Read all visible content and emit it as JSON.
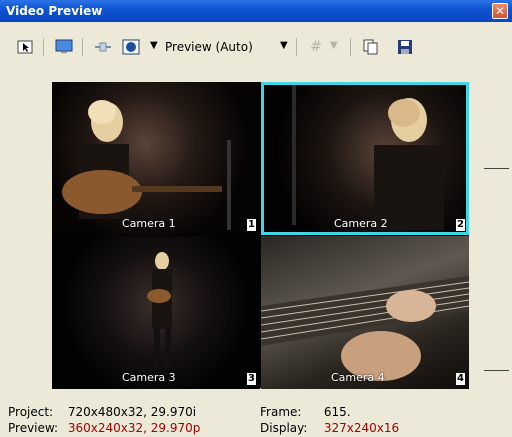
{
  "window": {
    "title": "Video Preview"
  },
  "toolbar": {
    "preview_quality": "Preview (Auto)"
  },
  "cameras": [
    {
      "label": "Camera 1",
      "number": "1"
    },
    {
      "label": "Camera 2",
      "number": "2"
    },
    {
      "label": "Camera 3",
      "number": "3"
    },
    {
      "label": "Camera 4",
      "number": "4"
    }
  ],
  "status": {
    "project_key": "Project:",
    "project_value": "720x480x32, 29.970i",
    "preview_key": "Preview:",
    "preview_value": "360x240x32, 29.970p",
    "frame_key": "Frame:",
    "frame_value": "615.",
    "display_key": "Display:",
    "display_value": "327x240x16"
  },
  "colors": {
    "selected_cell_border": "#3fd7e3",
    "status_value_red": "#a40000"
  }
}
